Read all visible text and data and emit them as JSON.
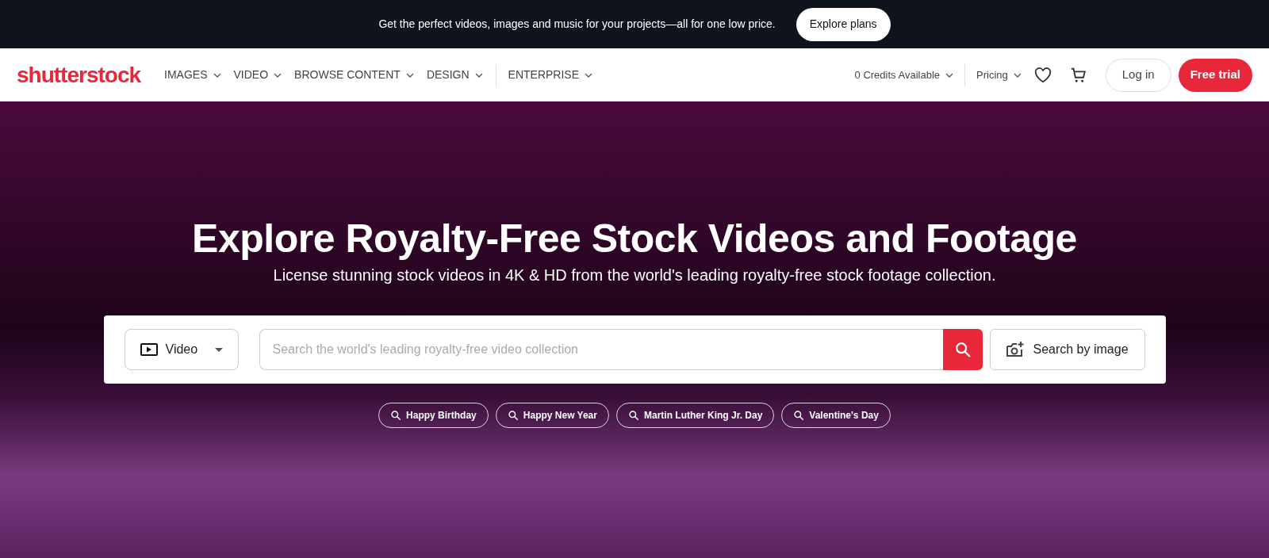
{
  "promo_bar": {
    "text": "Get the perfect videos, images and music for your projects—all for one low price.",
    "button": "Explore plans"
  },
  "header": {
    "logo": "shutterstock",
    "nav": [
      {
        "label": "IMAGES",
        "divider_before": false
      },
      {
        "label": "VIDEO",
        "divider_before": false
      },
      {
        "label": "BROWSE CONTENT",
        "divider_before": false
      },
      {
        "label": "DESIGN",
        "divider_before": false
      },
      {
        "label": "ENTERPRISE",
        "divider_before": true
      }
    ],
    "credits": "0 Credits Available",
    "pricing": "Pricing",
    "login": "Log in",
    "free_trial": "Free trial"
  },
  "hero": {
    "title": "Explore Royalty-Free Stock Videos and Footage",
    "subtitle": "License stunning stock videos in 4K & HD from the world's leading royalty-free stock footage collection.",
    "search": {
      "media_type": "Video",
      "placeholder": "Search the world's leading royalty-free video collection",
      "image_search": "Search by image"
    },
    "suggestions": [
      "Happy Birthday",
      "Happy New Year",
      "Martin Luther King Jr. Day",
      "Valentine's Day"
    ]
  }
}
